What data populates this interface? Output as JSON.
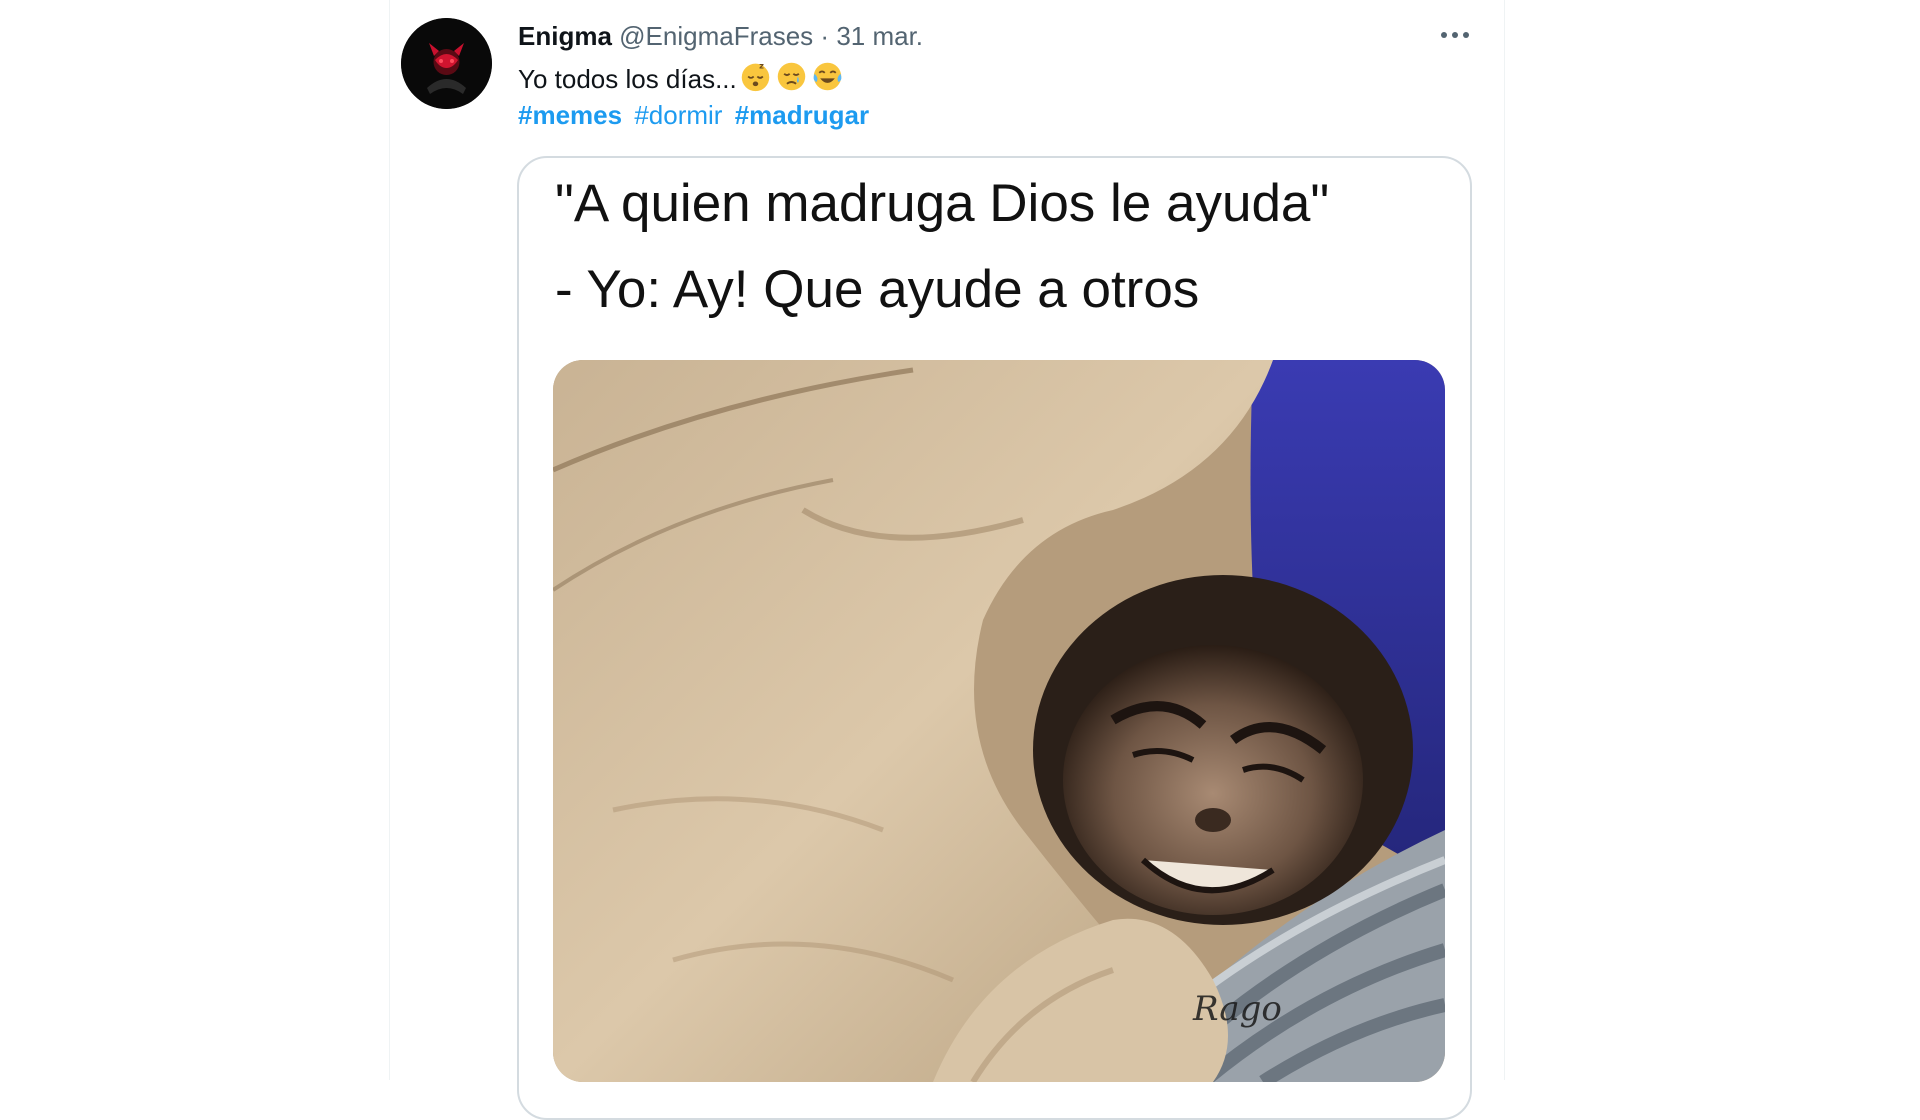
{
  "tweet": {
    "author_name": "Enigma",
    "handle": "@EnigmaFrases",
    "separator": "·",
    "date": "31 mar.",
    "text": "Yo todos los días...",
    "emojis": [
      "sleeping-face",
      "crying-face",
      "tears-of-joy-face"
    ],
    "hashtags": [
      "#memes",
      "#dormir",
      "#madrugar"
    ],
    "more_icon": "ellipsis-horizontal-icon"
  },
  "media": {
    "line_1": "\"A quien madruga Dios le ayuda\"",
    "line_2": "- Yo: Ay! Que ayude a otros",
    "watermark": "Rago",
    "photo": "monkey-under-blanket"
  },
  "colors": {
    "link": "#1d9bf0",
    "text": "#0f1419",
    "secondary": "#536471",
    "card_border": "#d4dbe0",
    "blanket": "#cdb89c",
    "pillow_blue": "#2d2f9e"
  }
}
